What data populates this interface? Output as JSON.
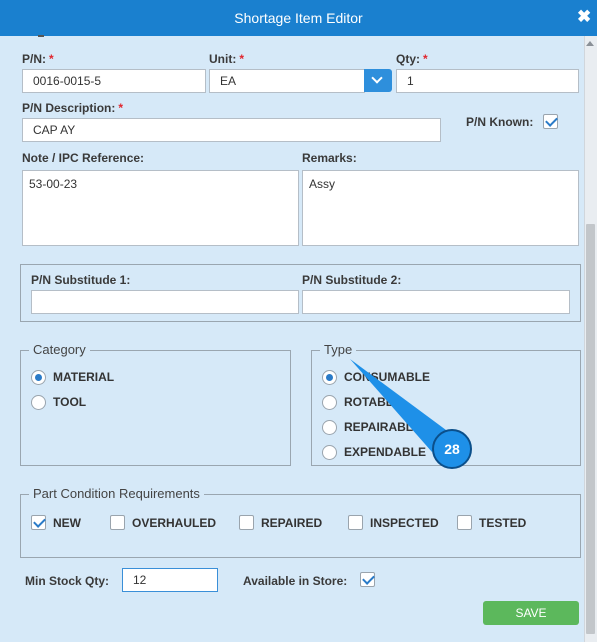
{
  "dialog": {
    "title": "Shortage Item Editor",
    "close_glyph": "✖"
  },
  "fields": {
    "pn": {
      "label": "P/N:",
      "required": "*",
      "value": "0016-0015-5"
    },
    "unit": {
      "label": "Unit:",
      "required": "*",
      "value": "EA"
    },
    "qty": {
      "label": "Qty:",
      "required": "*",
      "value": "1"
    },
    "pn_description": {
      "label": "P/N Description:",
      "required": "*",
      "value": "CAP AY"
    },
    "pn_known": {
      "label": "P/N Known:",
      "checked": true
    },
    "note_ipc": {
      "label": "Note / IPC Reference:",
      "value": "53-00-23"
    },
    "remarks": {
      "label": "Remarks:",
      "value": "Assy"
    },
    "pn_sub1": {
      "label": "P/N Substitude 1:",
      "value": ""
    },
    "pn_sub2": {
      "label": "P/N Substitude 2:",
      "value": ""
    },
    "min_stock_qty": {
      "label": "Min Stock Qty:",
      "value": "12"
    },
    "available_in_store": {
      "label": "Available in Store:",
      "checked": true
    }
  },
  "category": {
    "legend": "Category",
    "options": [
      {
        "label": "MATERIAL",
        "selected": true
      },
      {
        "label": "TOOL",
        "selected": false
      }
    ]
  },
  "type": {
    "legend": "Type",
    "options": [
      {
        "label": "CONSUMABLE",
        "selected": true
      },
      {
        "label": "ROTABLE",
        "selected": false
      },
      {
        "label": "REPAIRABLE",
        "selected": false
      },
      {
        "label": "EXPENDABLE",
        "selected": false
      }
    ]
  },
  "part_condition": {
    "legend": "Part Condition Requirements",
    "options": [
      {
        "label": "NEW",
        "checked": true
      },
      {
        "label": "OVERHAULED",
        "checked": false
      },
      {
        "label": "REPAIRED",
        "checked": false
      },
      {
        "label": "INSPECTED",
        "checked": false
      },
      {
        "label": "TESTED",
        "checked": false
      }
    ]
  },
  "actions": {
    "save_label": "SAVE"
  },
  "callout": {
    "number": "28",
    "color": "#1e90e8"
  },
  "colors": {
    "titlebar": "#1a80cf",
    "save": "#5cb85c",
    "background": "#d6e9f8"
  }
}
